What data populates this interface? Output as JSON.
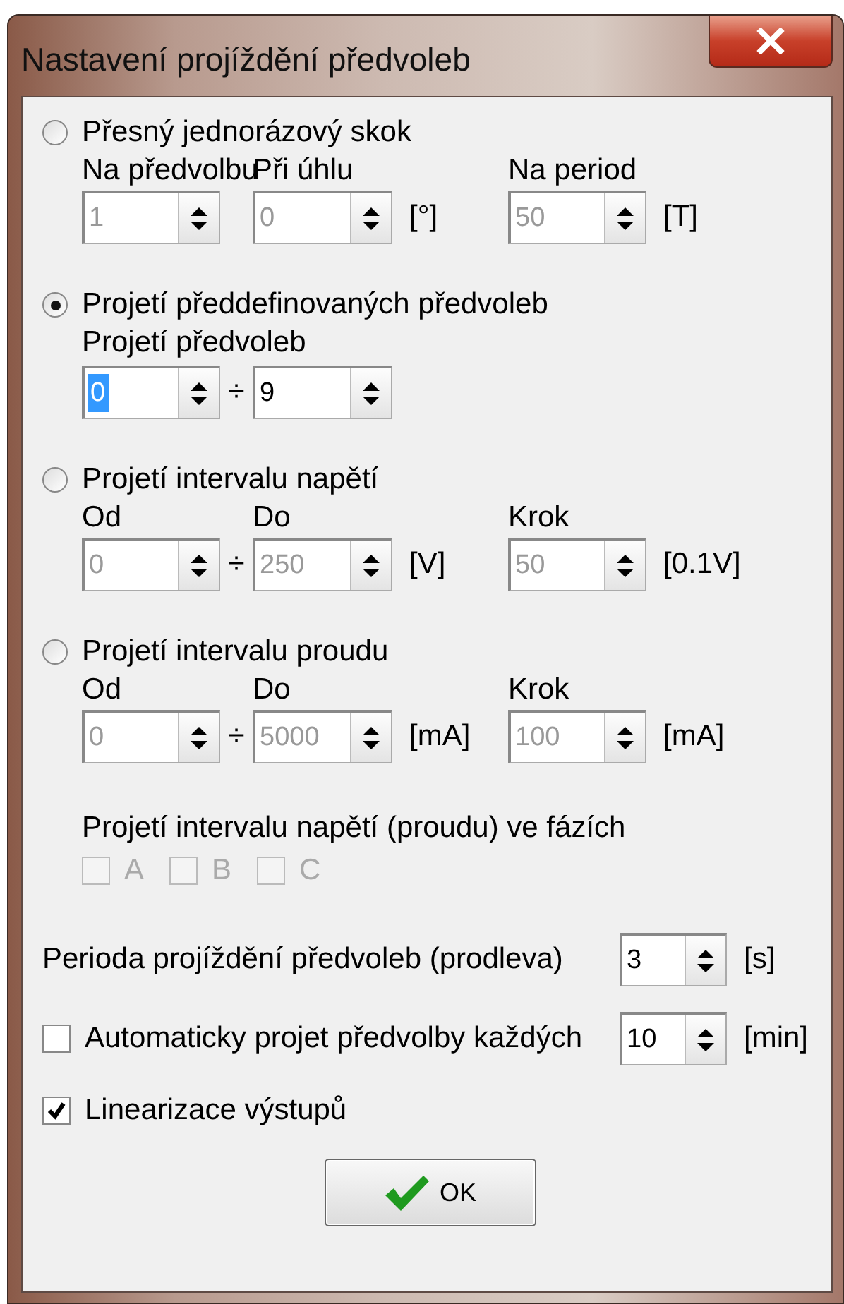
{
  "window": {
    "title": "Nastavení projíždění předvoleb"
  },
  "modes": [
    {
      "label": "Přesný jednorázový skok",
      "selected": false,
      "fields": [
        {
          "label": "Na předvolbu",
          "value": "1",
          "disabled": true,
          "focused": false
        },
        {
          "label": "Při úhlu",
          "value": "0",
          "disabled": true,
          "focused": false,
          "unit": "[°]"
        },
        {
          "label": "Na period",
          "value": "50",
          "disabled": true,
          "focused": false,
          "unit": "[T]"
        }
      ]
    },
    {
      "label": "Projetí předdefinovaných předvoleb",
      "selected": true,
      "group_label": "Projetí předvoleb",
      "fields": [
        {
          "value": "0",
          "disabled": false,
          "focused": true
        },
        {
          "prefix": "÷",
          "value": "9",
          "disabled": false,
          "focused": false
        }
      ]
    },
    {
      "label": "Projetí intervalu napětí",
      "selected": false,
      "fields": [
        {
          "label": "Od",
          "value": "0",
          "disabled": true,
          "focused": false
        },
        {
          "label": "Do",
          "prefix": "÷",
          "value": "250",
          "disabled": true,
          "focused": false,
          "unit": "[V]"
        },
        {
          "label": "Krok",
          "value": "50",
          "disabled": true,
          "focused": false,
          "unit": "[0.1V]"
        }
      ]
    },
    {
      "label": "Projetí intervalu proudu",
      "selected": false,
      "fields": [
        {
          "label": "Od",
          "value": "0",
          "disabled": true,
          "focused": false
        },
        {
          "label": "Do",
          "prefix": "÷",
          "value": "5000",
          "disabled": true,
          "focused": false,
          "unit": "[mA]"
        },
        {
          "label": "Krok",
          "value": "100",
          "disabled": true,
          "focused": false,
          "unit": "[mA]"
        }
      ]
    }
  ],
  "phases": {
    "label": "Projetí intervalu napětí (proudu) ve fázích",
    "items": [
      {
        "label": "A",
        "checked": false,
        "disabled": true
      },
      {
        "label": "B",
        "checked": false,
        "disabled": true
      },
      {
        "label": "C",
        "checked": false,
        "disabled": true
      }
    ]
  },
  "period": {
    "label": "Perioda projíždění předvoleb (prodleva)",
    "value": "3",
    "unit": "[s]"
  },
  "auto": {
    "label": "Automaticky projet předvolby každých",
    "checked": false,
    "value": "10",
    "unit": "[min]"
  },
  "linearization": {
    "label": "Linearizace výstupů",
    "checked": true
  },
  "ok_button": {
    "label": "OK"
  }
}
